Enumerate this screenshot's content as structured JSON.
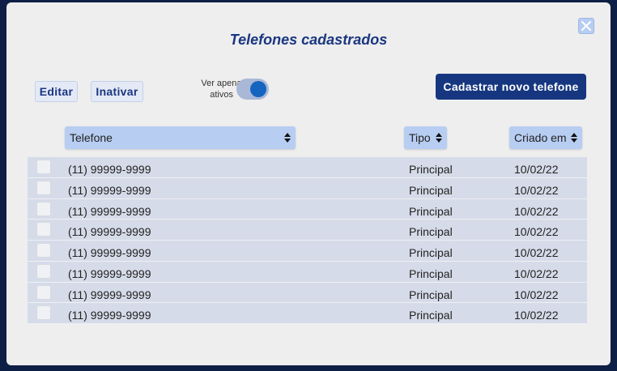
{
  "dialog": {
    "title": "Telefones cadastrados"
  },
  "toolbar": {
    "edit_label": "Editar",
    "deactivate_label": "Inativar",
    "toggle_label_line1": "Ver apenas",
    "toggle_label_line2": "ativos",
    "toggle_on": true,
    "new_phone_label": "Cadastrar novo telefone"
  },
  "table": {
    "headers": {
      "phone": "Telefone",
      "type": "Tipo",
      "created": "Criado em"
    },
    "rows": [
      {
        "phone": "(11) 99999-9999",
        "type": "Principal",
        "created": "10/02/22"
      },
      {
        "phone": "(11) 99999-9999",
        "type": "Principal",
        "created": "10/02/22"
      },
      {
        "phone": "(11) 99999-9999",
        "type": "Principal",
        "created": "10/02/22"
      },
      {
        "phone": "(11) 99999-9999",
        "type": "Principal",
        "created": "10/02/22"
      },
      {
        "phone": "(11) 99999-9999",
        "type": "Principal",
        "created": "10/02/22"
      },
      {
        "phone": "(11) 99999-9999",
        "type": "Principal",
        "created": "10/02/22"
      },
      {
        "phone": "(11) 99999-9999",
        "type": "Principal",
        "created": "10/02/22"
      },
      {
        "phone": "(11) 99999-9999",
        "type": "Principal",
        "created": "10/02/22"
      }
    ]
  },
  "icons": {
    "close": "close-icon",
    "sort": "sort-icon"
  },
  "colors": {
    "primary": "#163780",
    "header_bg": "#b7cdf2",
    "row_bg": "#d5dbe8",
    "toggle_knob": "#1565c0"
  }
}
